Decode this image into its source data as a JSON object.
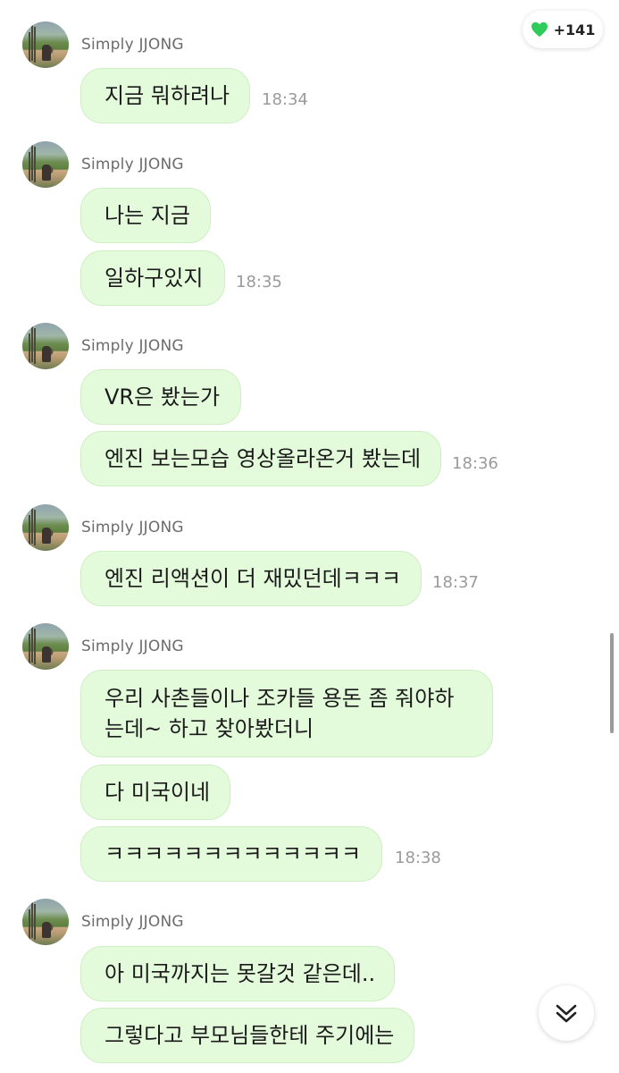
{
  "reactions": {
    "icon": "green-heart-icon",
    "count": "+141",
    "color": "#2ecc5a"
  },
  "sender_name": "Simply JJONG",
  "groups": [
    {
      "messages": [
        {
          "text": "지금 뭐하려나",
          "time": "18:34"
        }
      ]
    },
    {
      "messages": [
        {
          "text": "나는 지금",
          "time": ""
        },
        {
          "text": "일하구있지",
          "time": "18:35"
        }
      ]
    },
    {
      "messages": [
        {
          "text": "VR은 봤는가",
          "time": ""
        },
        {
          "text": "엔진 보는모습 영상올라온거 봤는데",
          "time": "18:36"
        }
      ]
    },
    {
      "messages": [
        {
          "text": "엔진 리액션이 더 재밌던데ㅋㅋㅋ",
          "time": "18:37"
        }
      ]
    },
    {
      "messages": [
        {
          "text": "우리 사촌들이나 조카들 용돈 좀 줘야하는데~ 하고 찾아봤더니",
          "time": ""
        },
        {
          "text": "다 미국이네",
          "time": ""
        },
        {
          "text": "ㅋㅋㅋㅋㅋㅋㅋㅋㅋㅋㅋㅋㅋ",
          "time": "18:38"
        }
      ]
    },
    {
      "messages": [
        {
          "text": "아 미국까지는 못갈것 같은데..",
          "time": ""
        },
        {
          "text": "그렇다고 부모님들한테 주기에는",
          "time": ""
        }
      ]
    }
  ],
  "bubble_color": "#e3fbdb",
  "scroll_button_icon": "double-chevron-down-icon"
}
